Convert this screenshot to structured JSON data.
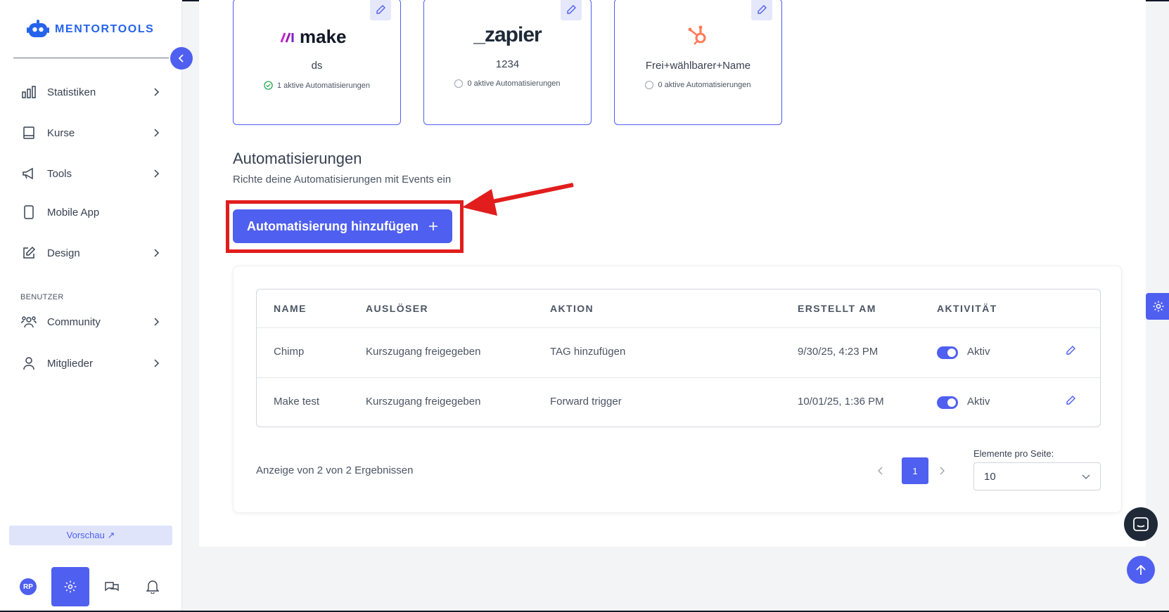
{
  "sidebar": {
    "logo_text": "MENTORTOOLS",
    "items": [
      {
        "label": "Statistiken"
      },
      {
        "label": "Kurse"
      },
      {
        "label": "Tools"
      },
      {
        "label": "Mobile App"
      },
      {
        "label": "Design"
      }
    ],
    "section_users": "BENUTZER",
    "user_items": [
      {
        "label": "Community"
      },
      {
        "label": "Mitglieder"
      }
    ],
    "preview_label": "Vorschau ↗",
    "avatar_initials": "RP"
  },
  "integrations": [
    {
      "logo": "make",
      "name": "ds",
      "status": "1 aktive Automatisierungen",
      "active": true
    },
    {
      "logo": "_zapier",
      "name": "1234",
      "status": "0 aktive Automatisierungen",
      "active": false
    },
    {
      "logo": "hubspot",
      "name": "Frei+wählbarer+Name",
      "status": "0 aktive Automatisierungen",
      "active": false
    }
  ],
  "automations": {
    "title": "Automatisierungen",
    "subtitle": "Richte deine Automatisierungen mit Events ein",
    "add_button": "Automatisierung hinzufügen",
    "columns": [
      "NAME",
      "AUSLÖSER",
      "AKTION",
      "ERSTELLT AM",
      "AKTIVITÄT"
    ],
    "rows": [
      {
        "name": "Chimp",
        "trigger": "Kurszugang freigegeben",
        "action": "TAG hinzufügen",
        "created": "9/30/25, 4:23 PM",
        "status": "Aktiv"
      },
      {
        "name": "Make test",
        "trigger": "Kurszugang freigegeben",
        "action": "Forward trigger",
        "created": "10/01/25, 1:36 PM",
        "status": "Aktiv"
      }
    ],
    "results_text": "Anzeige von 2 von 2 Ergebnissen",
    "current_page": "1",
    "per_page_label": "Elemente pro Seite:",
    "per_page_value": "10"
  },
  "colors": {
    "accent": "#4f5ff0",
    "highlight": "#e11d1d",
    "make_magenta": "#c026d3",
    "zapier_orange": "#ff4a00",
    "hubspot_orange": "#ff7a59"
  }
}
